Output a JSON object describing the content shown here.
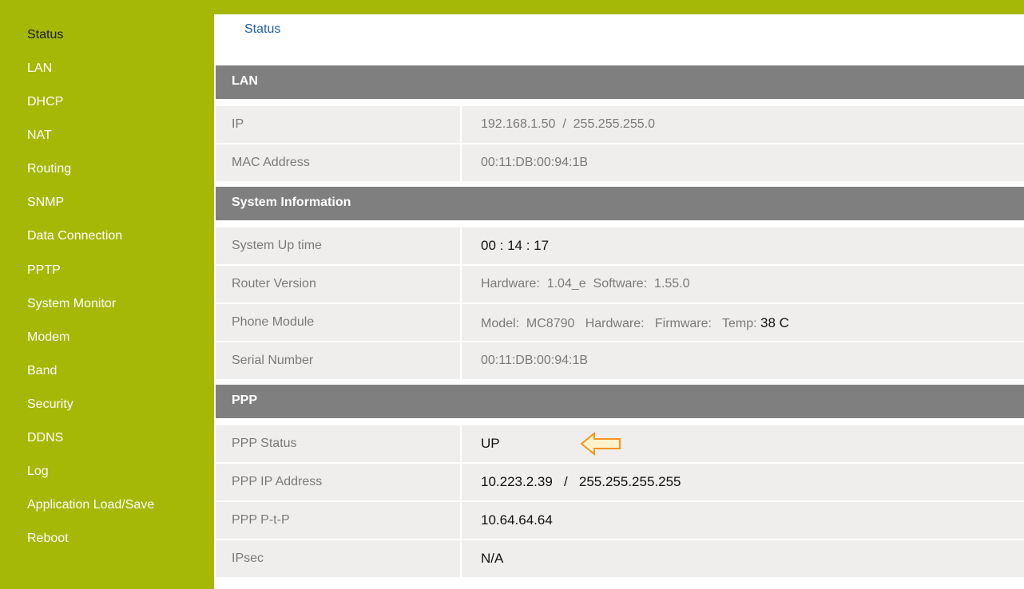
{
  "sidebar": {
    "items": [
      {
        "label": "Status"
      },
      {
        "label": "LAN"
      },
      {
        "label": "DHCP"
      },
      {
        "label": "NAT"
      },
      {
        "label": "Routing"
      },
      {
        "label": "SNMP"
      },
      {
        "label": "Data Connection"
      },
      {
        "label": "PPTP"
      },
      {
        "label": "System Monitor"
      },
      {
        "label": "Modem"
      },
      {
        "label": "Band"
      },
      {
        "label": "Security"
      },
      {
        "label": "DDNS"
      },
      {
        "label": "Log"
      },
      {
        "label": "Application Load/Save"
      },
      {
        "label": "Reboot"
      }
    ]
  },
  "breadcrumb": "Status",
  "sections": {
    "lan": {
      "title": "LAN",
      "ip_label": "IP",
      "ip_value": "192.168.1.50  /  255.255.255.0",
      "mac_label": "MAC Address",
      "mac_value": "00:11:DB:00:94:1B"
    },
    "system": {
      "title": "System Information",
      "uptime_label": "System Up time",
      "uptime_value": "00 : 14 : 17",
      "router_label": "Router Version",
      "router_value": "Hardware:  1.04_e  Software:  1.55.0",
      "phone_label": "Phone Module",
      "phone_value": "Model:  MC8790   Hardware:   Firmware:   Temp: ",
      "phone_temp": "38 C",
      "serial_label": "Serial Number",
      "serial_value": "00:11:DB:00:94:1B"
    },
    "ppp": {
      "title": "PPP",
      "status_label": "PPP Status",
      "status_value": "UP",
      "ip_label": "PPP IP Address",
      "ip_value": "10.223.2.39   /   255.255.255.255",
      "ptp_label": "PPP P-t-P",
      "ptp_value": "10.64.64.64",
      "ipsec_label": "IPsec",
      "ipsec_value": "N/A"
    }
  },
  "colors": {
    "sidebar_bg": "#a4b805",
    "section_header_bg": "#7f7f7f",
    "row_bg": "#efeeec",
    "link": "#1f5fa8",
    "arrow_stroke": "#f7941d",
    "arrow_fill": "#fff3cc"
  },
  "icons": {
    "annotation_arrow": "left-arrow-icon"
  }
}
